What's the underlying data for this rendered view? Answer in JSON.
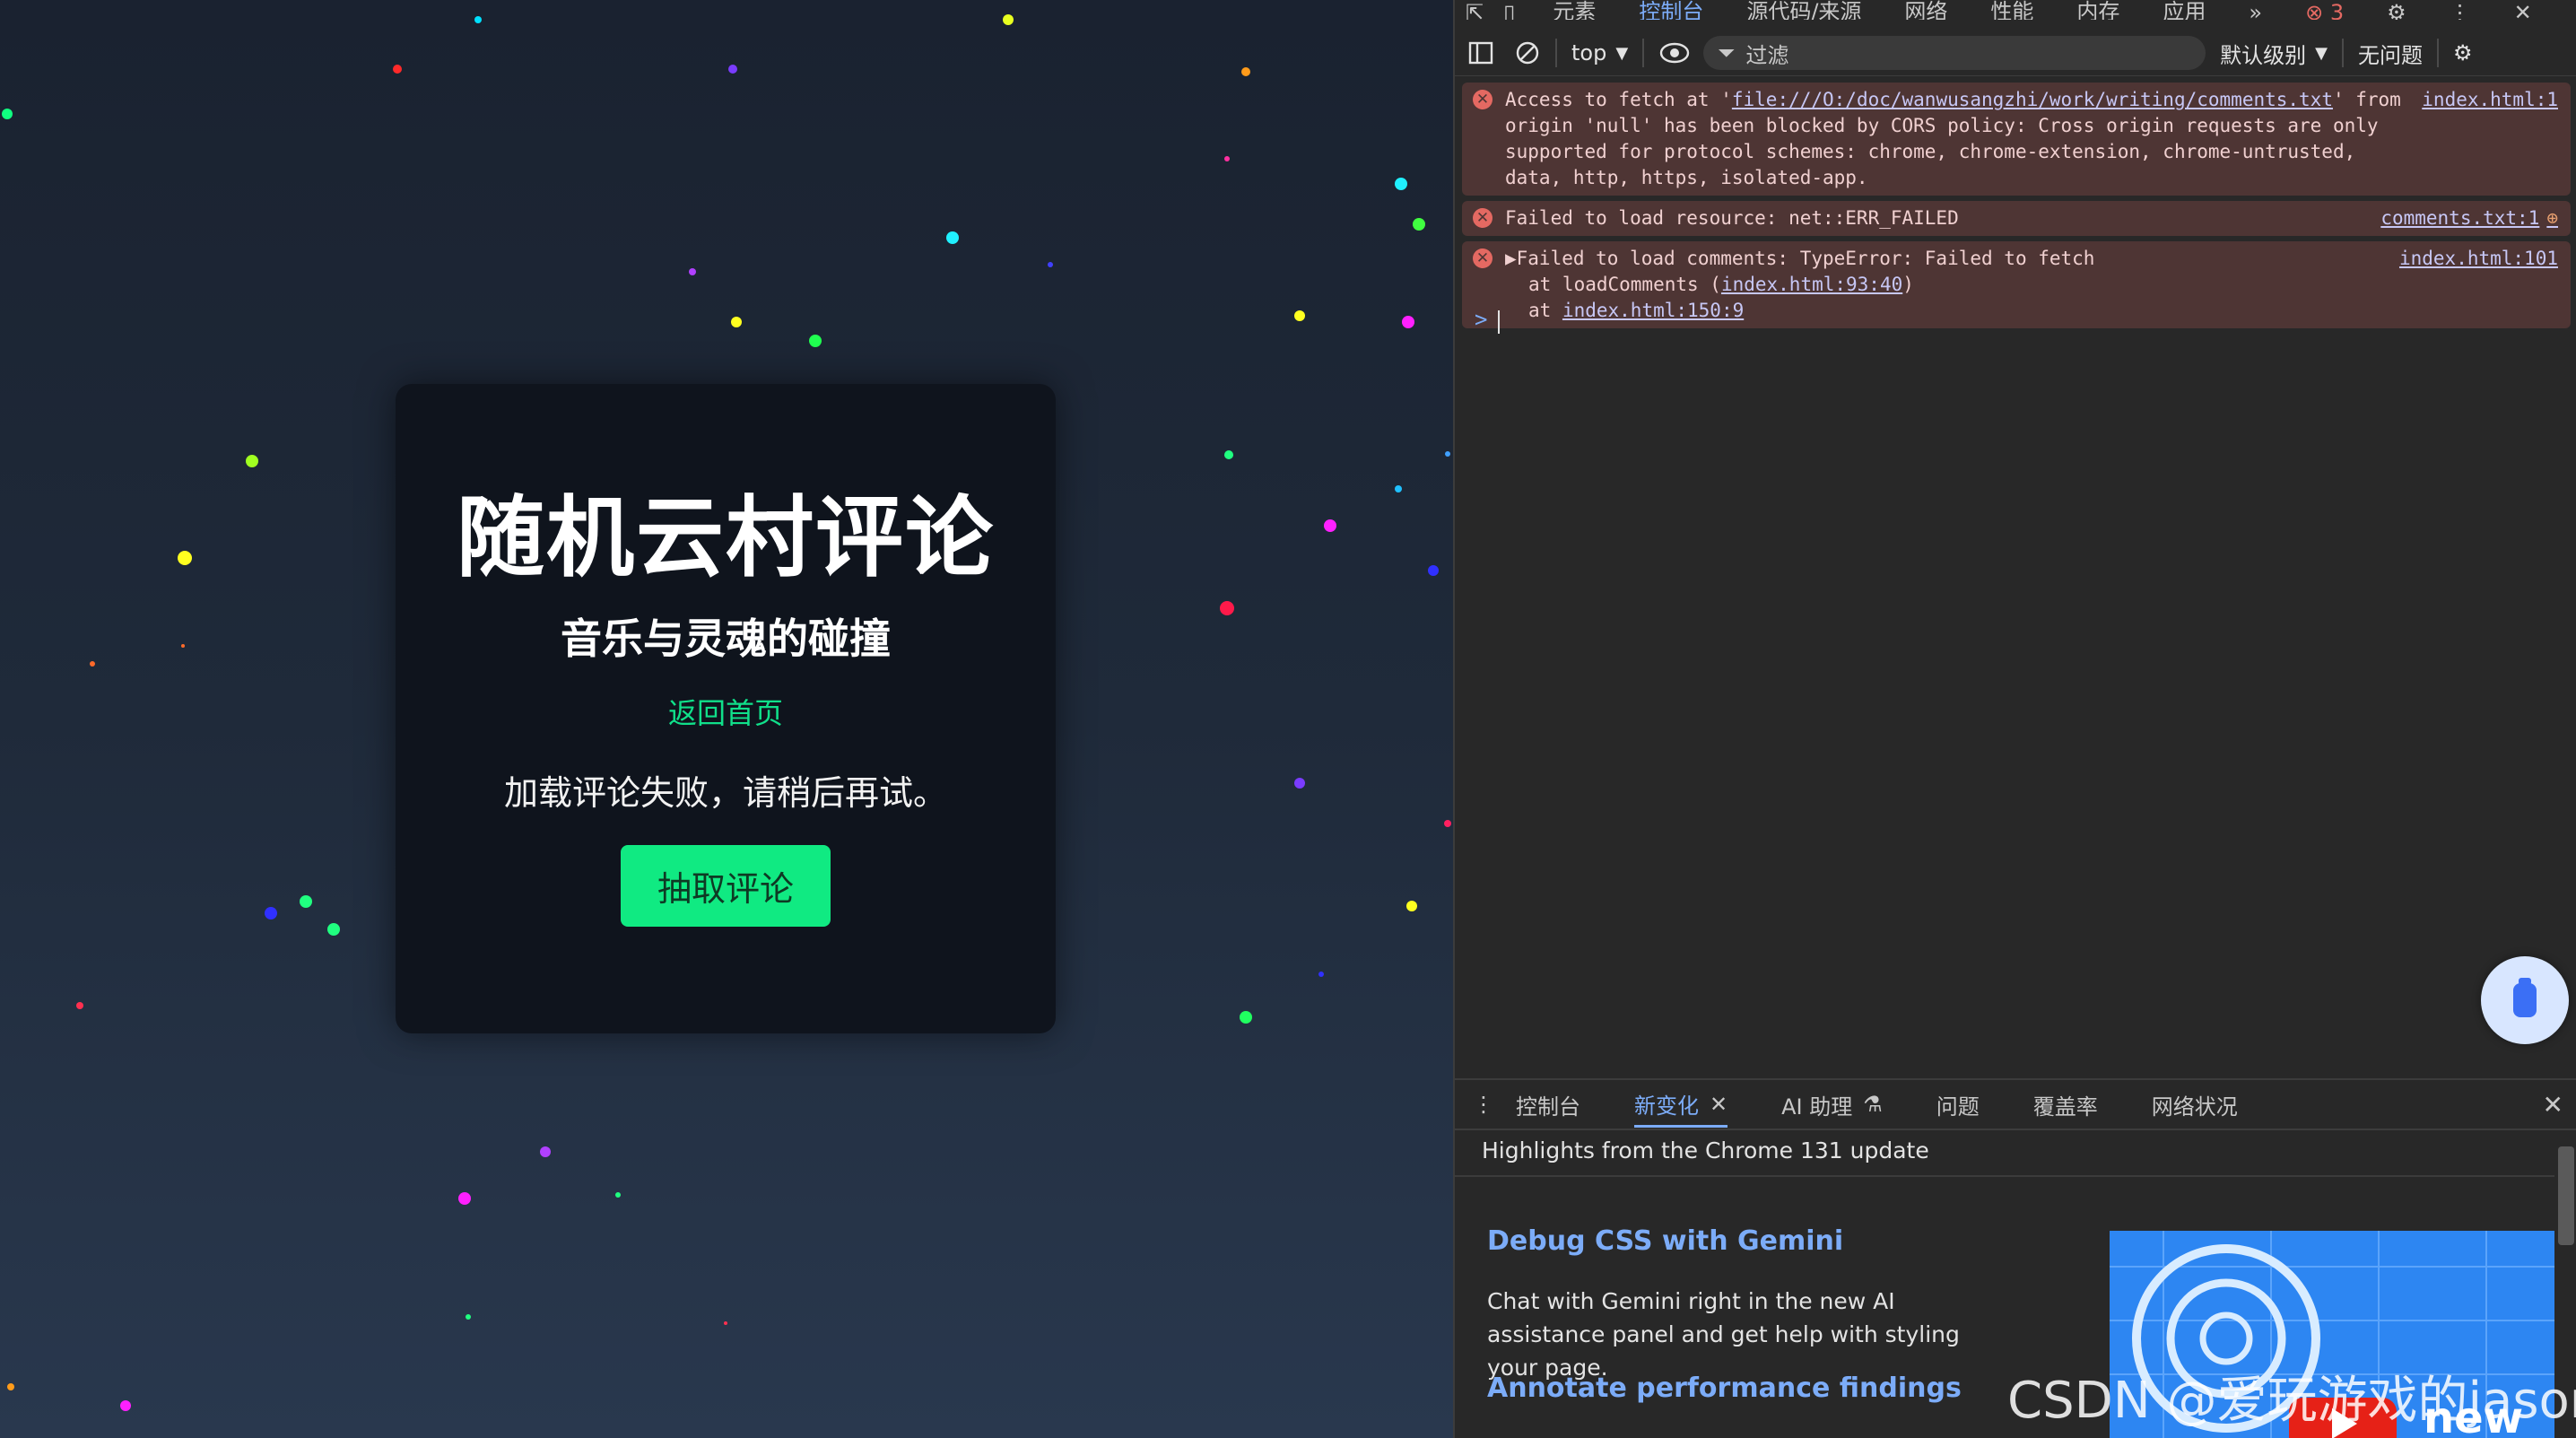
{
  "page": {
    "title": "随机云村评论",
    "subtitle": "音乐与灵魂的碰撞",
    "back_link": "返回首页",
    "message": "加载评论失败，请稍后再试。",
    "draw_button": "抽取评论",
    "colors": {
      "card": "#0f141d",
      "accent": "#10ea82",
      "link": "#10e08a"
    }
  },
  "devtools": {
    "top_tabs": [
      "元素",
      "控制台",
      "源代码/来源",
      "网络",
      "性能",
      "内存",
      "应用"
    ],
    "active_tab": "控制台",
    "more": "»",
    "error_count": "3",
    "toolbar": {
      "context": "top",
      "filter_placeholder": "过滤",
      "level": "默认级别",
      "issues": "无问题"
    },
    "console": [
      {
        "lines": [
          "Access to fetch at '",
          "file:///O:/doc/wanwusangzhi/work/writing/comments.txt",
          "' from origin 'null' has been blocked by CORS policy: Cross origin requests are only supported for protocol schemes: chrome, chrome-extension, chrome-untrusted, data, http, https, isolated-app."
        ],
        "source": "index.html:1"
      },
      {
        "text": "Failed to load resource: net::ERR_FAILED",
        "source": "comments.txt:1"
      },
      {
        "text": "▶Failed to load comments: TypeError: Failed to fetch",
        "stack1_prefix": "at loadComments (",
        "stack1_link": "index.html:93:40",
        "stack1_suffix": ")",
        "stack2_prefix": "at ",
        "stack2_link": "index.html:150:9",
        "source": "index.html:101"
      }
    ],
    "prompt": ">",
    "drawer": {
      "tabs": [
        "控制台",
        "新变化",
        "AI 助理",
        "问题",
        "覆盖率",
        "网络状况"
      ],
      "active": "新变化",
      "header": "Highlights from the Chrome 131 update",
      "item1_title": "Debug CSS with Gemini",
      "item1_body": "Chat with Gemini right in the new AI assistance panel and get help with styling your page.",
      "item2_title": "Annotate performance findings",
      "promo_text": "new"
    }
  },
  "watermark": "CSDN @爱玩游戏的jason"
}
